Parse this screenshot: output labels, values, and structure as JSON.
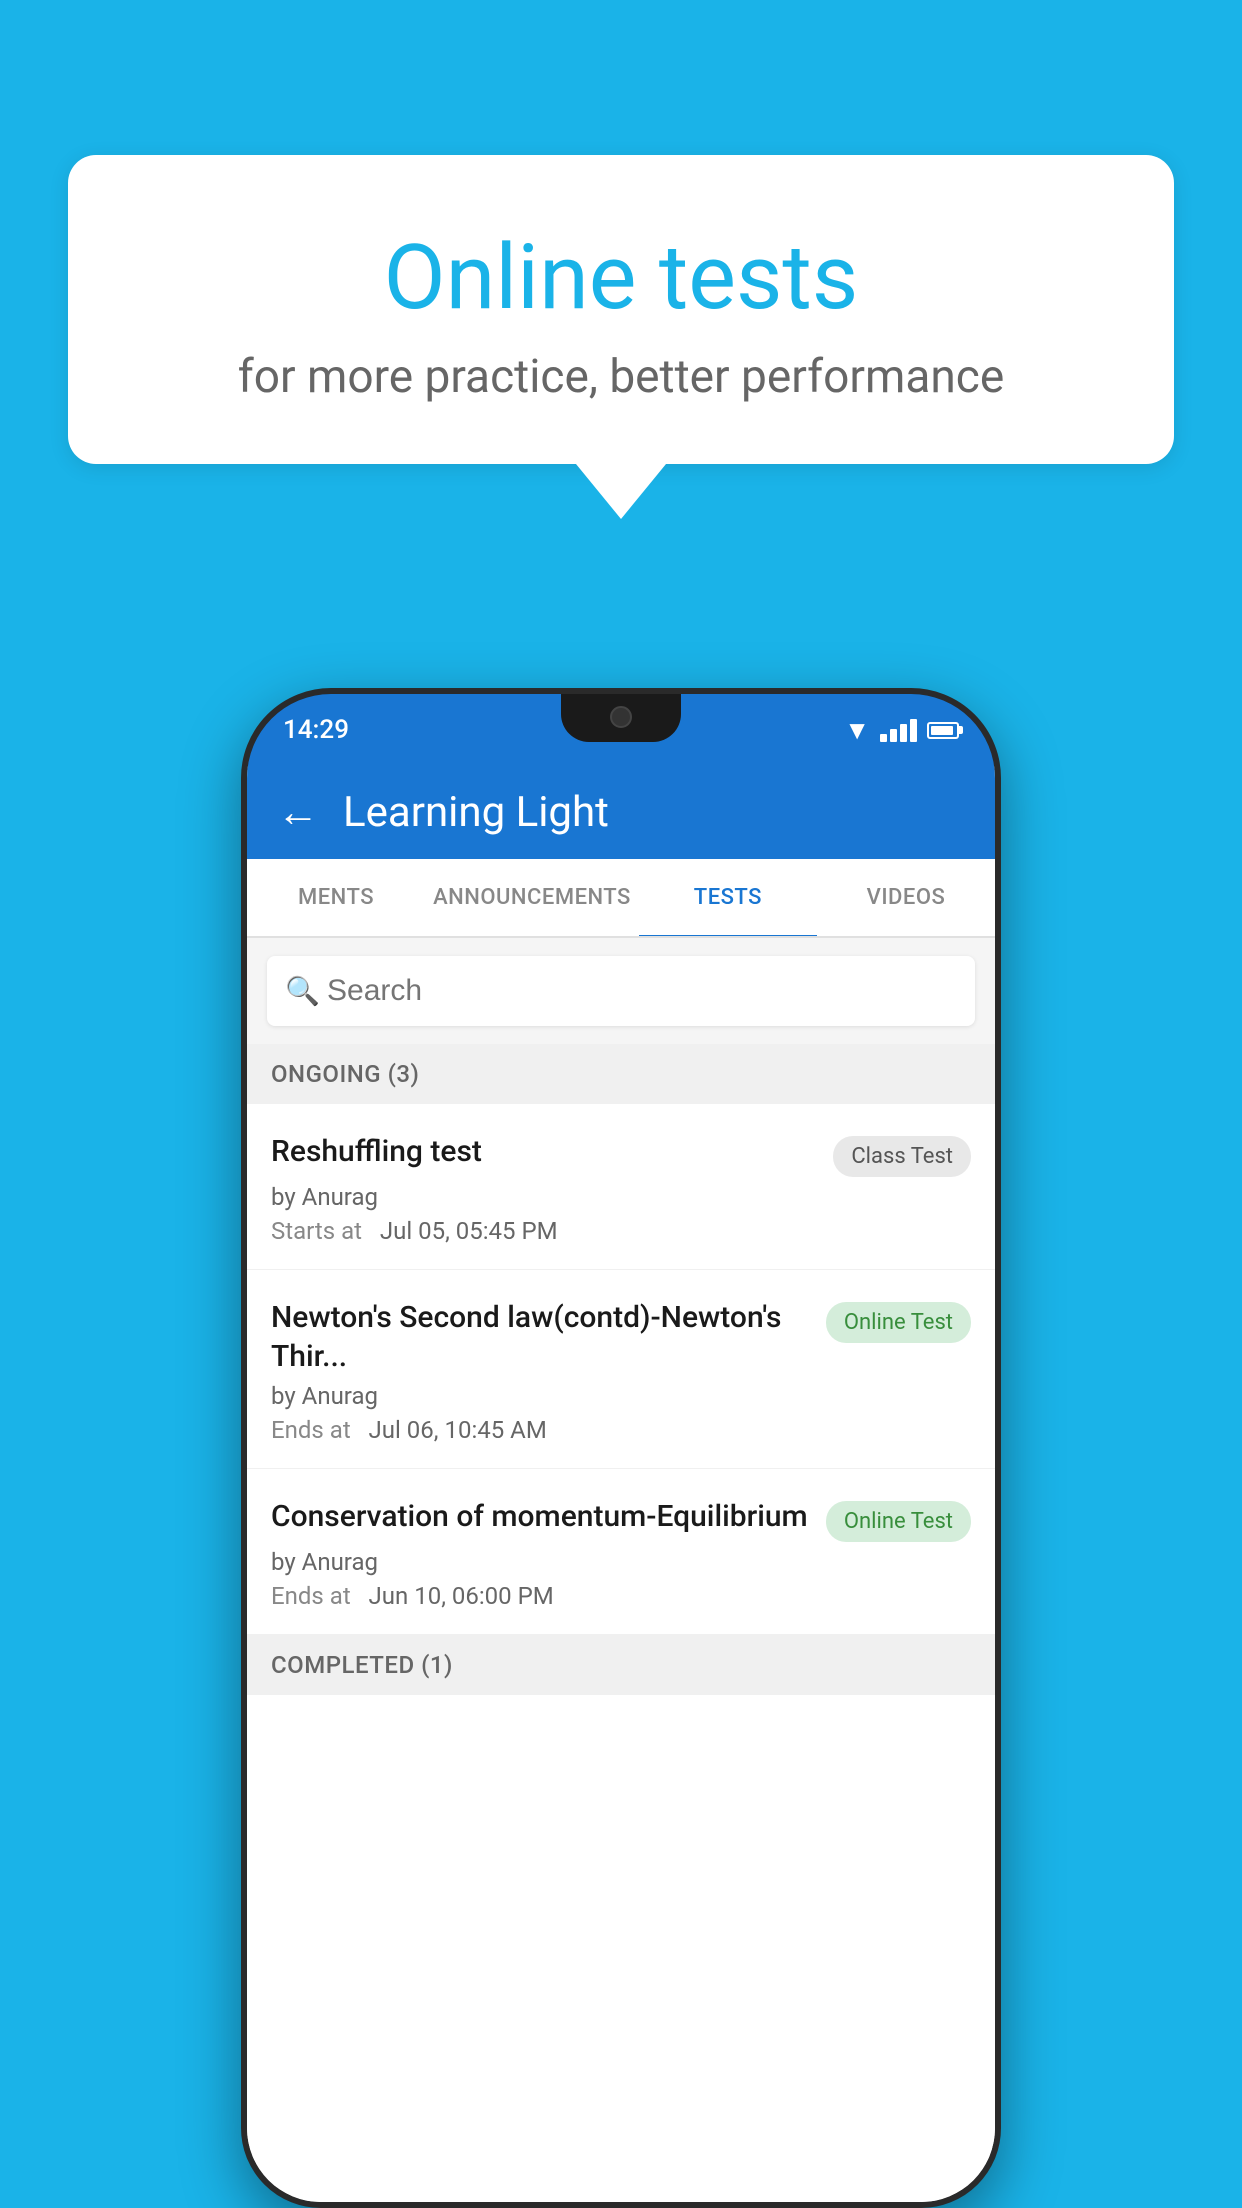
{
  "background_color": "#1ab3e8",
  "bubble": {
    "title": "Online tests",
    "subtitle": "for more practice, better performance"
  },
  "phone": {
    "status_bar": {
      "time": "14:29"
    },
    "header": {
      "title": "Learning Light",
      "back_label": "←"
    },
    "tabs": [
      {
        "label": "MENTS",
        "active": false
      },
      {
        "label": "ANNOUNCEMENTS",
        "active": false
      },
      {
        "label": "TESTS",
        "active": true
      },
      {
        "label": "VIDEOS",
        "active": false
      }
    ],
    "search": {
      "placeholder": "Search"
    },
    "ongoing_section": {
      "label": "ONGOING (3)"
    },
    "tests": [
      {
        "name": "Reshuffling test",
        "by": "by Anurag",
        "time_label": "Starts at",
        "time_value": "Jul 05, 05:45 PM",
        "badge": "Class Test",
        "badge_type": "class"
      },
      {
        "name": "Newton's Second law(contd)-Newton's Thir...",
        "by": "by Anurag",
        "time_label": "Ends at",
        "time_value": "Jul 06, 10:45 AM",
        "badge": "Online Test",
        "badge_type": "online"
      },
      {
        "name": "Conservation of momentum-Equilibrium",
        "by": "by Anurag",
        "time_label": "Ends at",
        "time_value": "Jun 10, 06:00 PM",
        "badge": "Online Test",
        "badge_type": "online"
      }
    ],
    "completed_section": {
      "label": "COMPLETED (1)"
    }
  }
}
